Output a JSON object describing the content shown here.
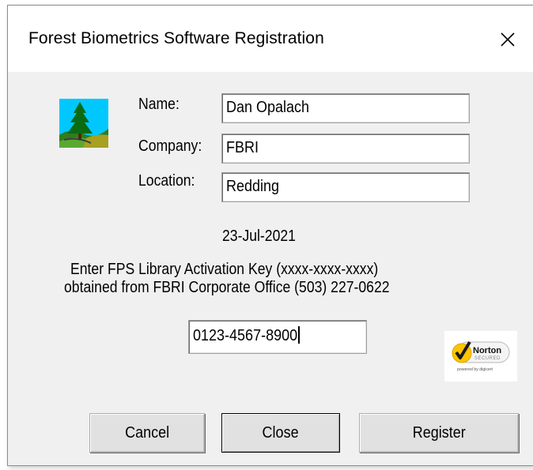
{
  "window": {
    "title": "Forest Biometrics Software Registration",
    "close_glyph": "✕"
  },
  "icons": {
    "app_logo": "tree-logo-icon",
    "security_seal": "norton-secured-seal"
  },
  "form": {
    "name_label": "Name:",
    "name_value": "Dan Opalach",
    "company_label": "Company:",
    "company_value": "FBRI",
    "location_label": "Location:",
    "location_value": "Redding"
  },
  "date": "23-Jul-2021",
  "instructions": {
    "line1": "Enter FPS Library Activation Key (xxxx-xxxx-xxxx)",
    "line2": "obtained from FBRI Corporate Office (503) 227-0622"
  },
  "activation_key": {
    "value": "0123-4567-8900"
  },
  "norton": {
    "brand": "Norton",
    "subtitle": "SECURED",
    "powered_by": "powered by digicert"
  },
  "buttons": {
    "cancel": "Cancel",
    "close": "Close",
    "register": "Register"
  },
  "colors": {
    "dialog_bg": "#f0f0f0",
    "title_bg": "#ffffff",
    "norton_yellow": "#ffc400"
  }
}
